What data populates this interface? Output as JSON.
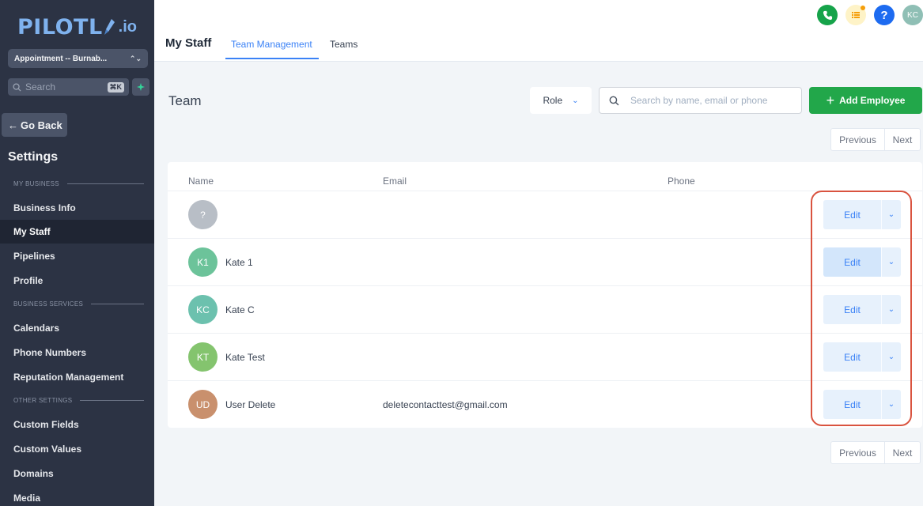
{
  "brand": {
    "name": "PILOTL",
    "suffix": ".io"
  },
  "sidebar": {
    "location": "Appointment -- Burnab...",
    "search_placeholder": "Search",
    "search_shortcut": "⌘K",
    "go_back": "Go Back",
    "settings_title": "Settings",
    "section_my_business": "MY BUSINESS",
    "section_business_services": "BUSINESS SERVICES",
    "section_other_settings": "OTHER SETTINGS",
    "items": [
      {
        "label": "Business Info"
      },
      {
        "label": "My Staff",
        "active": true
      },
      {
        "label": "Pipelines"
      },
      {
        "label": "Profile"
      },
      {
        "label": "Calendars"
      },
      {
        "label": "Phone Numbers"
      },
      {
        "label": "Reputation Management"
      },
      {
        "label": "Custom Fields"
      },
      {
        "label": "Custom Values"
      },
      {
        "label": "Domains"
      },
      {
        "label": "Media"
      }
    ]
  },
  "header": {
    "title": "My Staff",
    "tabs": [
      {
        "label": "Team Management",
        "active": true
      },
      {
        "label": "Teams"
      }
    ],
    "user_initials": "KC",
    "help_label": "?"
  },
  "main": {
    "title": "Team",
    "role_filter": "Role",
    "search_placeholder": "Search by name, email or phone",
    "add_button": "Add Employee",
    "pager": {
      "previous": "Previous",
      "next": "Next"
    },
    "columns": {
      "name": "Name",
      "email": "Email",
      "phone": "Phone"
    },
    "rows": [
      {
        "initials": "?",
        "name": "",
        "email": "",
        "avatar_color": "#b8bec6",
        "edit": "Edit"
      },
      {
        "initials": "K1",
        "name": "Kate 1",
        "email": "",
        "avatar_color": "#6cc39a",
        "edit": "Edit"
      },
      {
        "initials": "KC",
        "name": "Kate C",
        "email": "",
        "avatar_color": "#6cc1ae",
        "edit": "Edit"
      },
      {
        "initials": "KT",
        "name": "Kate Test",
        "email": "",
        "avatar_color": "#84c46e",
        "edit": "Edit"
      },
      {
        "initials": "UD",
        "name": "User Delete",
        "email": "deletecontacttest@gmail.com",
        "avatar_color": "#c9906d",
        "edit": "Edit"
      }
    ]
  },
  "colors": {
    "primary": "#3b82f6",
    "success": "#22a74a",
    "highlight": "#d9533f",
    "sidebar": "#2c3344"
  }
}
